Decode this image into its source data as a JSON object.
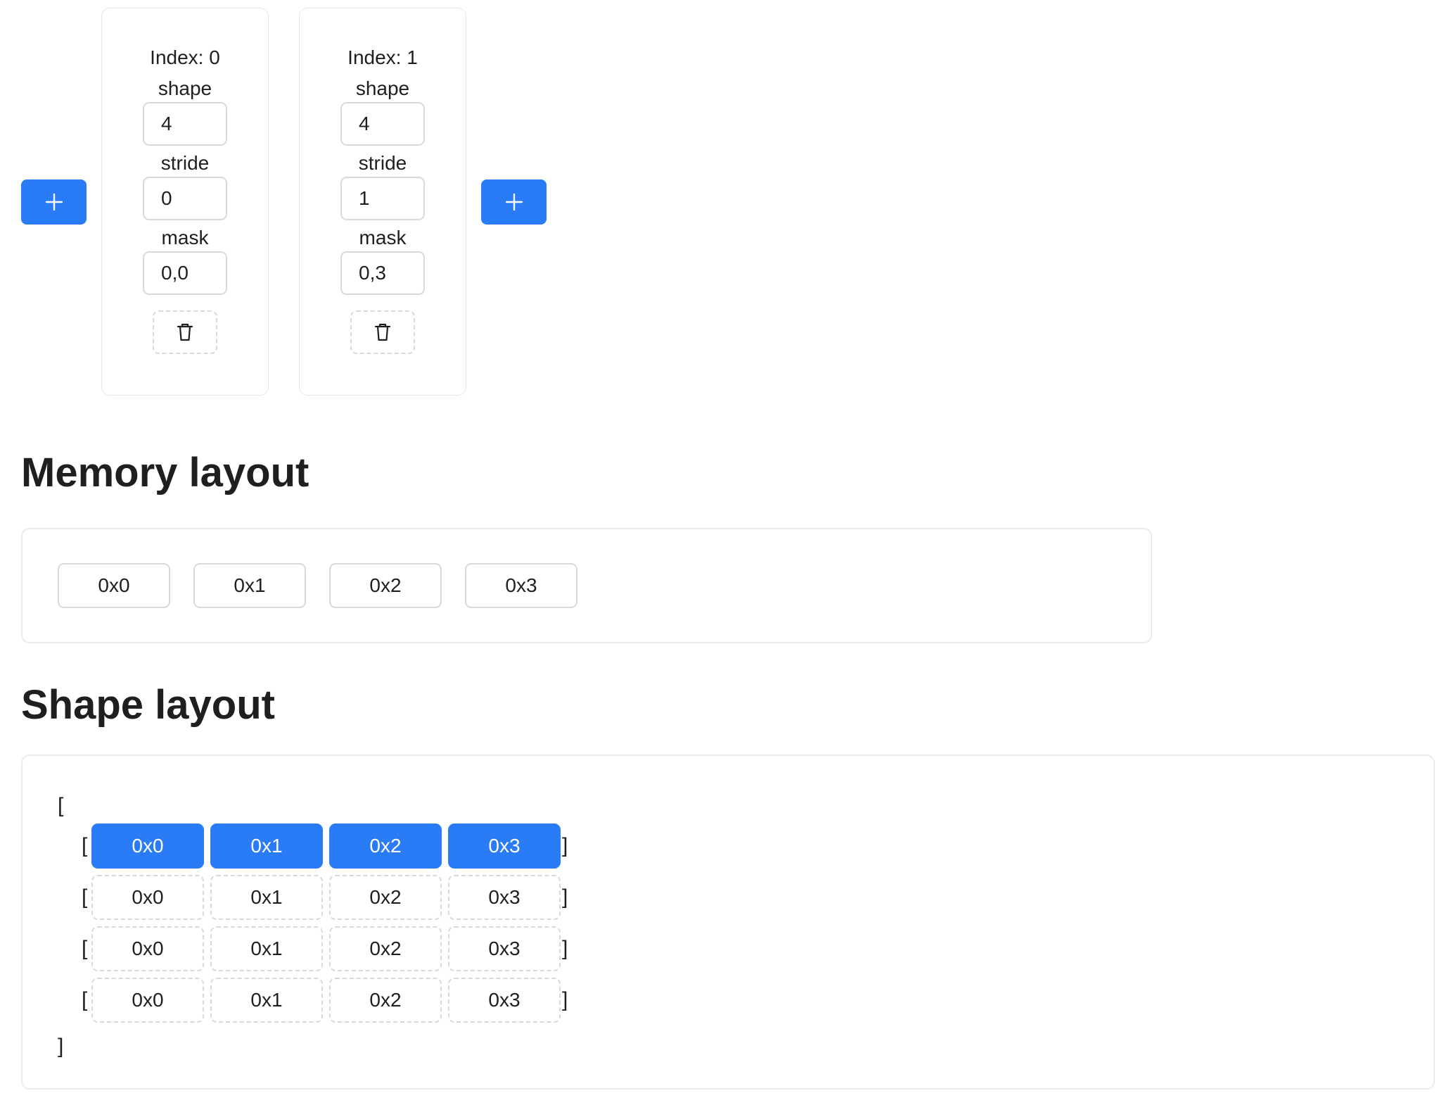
{
  "dimensions": [
    {
      "index_label": "Index: 0",
      "shape_label": "shape",
      "shape_value": "4",
      "stride_label": "stride",
      "stride_value": "0",
      "mask_label": "mask",
      "mask_value": "0,0"
    },
    {
      "index_label": "Index: 1",
      "shape_label": "shape",
      "shape_value": "4",
      "stride_label": "stride",
      "stride_value": "1",
      "mask_label": "mask",
      "mask_value": "0,3"
    }
  ],
  "icons": {
    "add": "plus-icon",
    "delete": "trash-icon"
  },
  "colors": {
    "accent": "#2a7cf6",
    "border": "#d9d9d9"
  },
  "memory": {
    "title": "Memory layout",
    "cells": [
      "0x0",
      "0x1",
      "0x2",
      "0x3"
    ]
  },
  "shape": {
    "title": "Shape layout",
    "open_bracket": "[",
    "close_bracket": "]",
    "rows": [
      {
        "open": "[",
        "close": "]",
        "cells": [
          "0x0",
          "0x1",
          "0x2",
          "0x3"
        ],
        "active": [
          true,
          true,
          true,
          true
        ]
      },
      {
        "open": "[",
        "close": "]",
        "cells": [
          "0x0",
          "0x1",
          "0x2",
          "0x3"
        ],
        "active": [
          false,
          false,
          false,
          false
        ]
      },
      {
        "open": "[",
        "close": "]",
        "cells": [
          "0x0",
          "0x1",
          "0x2",
          "0x3"
        ],
        "active": [
          false,
          false,
          false,
          false
        ]
      },
      {
        "open": "[",
        "close": "]",
        "cells": [
          "0x0",
          "0x1",
          "0x2",
          "0x3"
        ],
        "active": [
          false,
          false,
          false,
          false
        ]
      }
    ]
  }
}
